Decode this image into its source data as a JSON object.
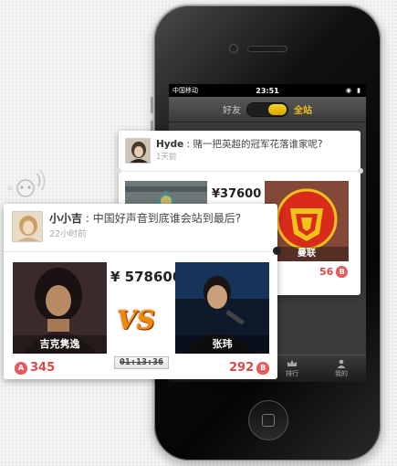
{
  "phone": {
    "status_bar": {
      "carrier": "中国移动",
      "time": "23:51"
    },
    "nav": {
      "friends_label": "好友",
      "all_label": "全站"
    },
    "tabs": [
      {
        "label": "排行",
        "icon": "crown-icon"
      },
      {
        "label": "我的",
        "icon": "user-icon"
      }
    ]
  },
  "back_card": {
    "user": "Hyde",
    "question": "赌一把英超的冠军花落谁家呢?",
    "time_ago": "1天前",
    "amount": "¥37600",
    "right_team": "曼联",
    "right_score": "56",
    "score_icon": "B"
  },
  "front_card": {
    "user": "小小吉",
    "question": "中国好声音到底谁会站到最后?",
    "time_ago": "22小时前",
    "amount": "¥ 578600",
    "vs_label": "VS",
    "timer": "01:13:36",
    "left_name": "吉克隽逸",
    "left_score": "345",
    "left_icon": "A",
    "right_name": "张玮",
    "right_score": "292",
    "right_icon": "B"
  },
  "colors": {
    "accent_yellow": "#f2c21b",
    "score_red": "#d94a4a",
    "vs_orange": "#f08a00"
  }
}
